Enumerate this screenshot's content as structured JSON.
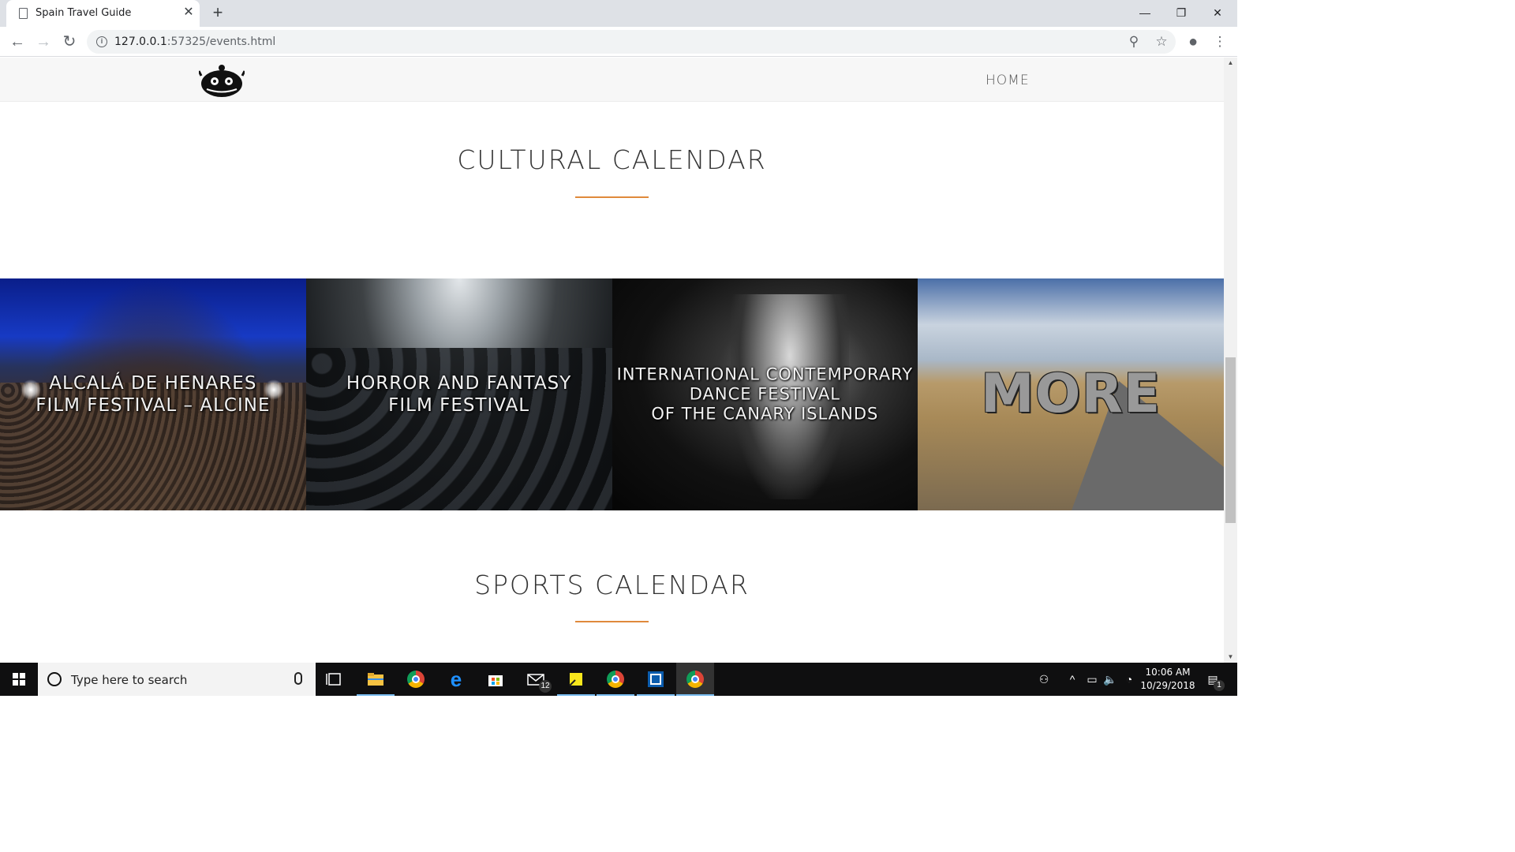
{
  "browser": {
    "tab_title": "Spain Travel Guide",
    "tab_close": "✕",
    "new_tab": "+",
    "url_host": "127.0.0.1",
    "url_rest": ":57325/events.html",
    "window_controls": {
      "minimize": "—",
      "maximize": "❐",
      "close": "✕"
    }
  },
  "site": {
    "nav": {
      "home": "HOME"
    },
    "cultural": {
      "title": "CULTURAL CALENDAR",
      "tiles": [
        {
          "label": "ALCALÁ DE HENARES\nFILM FESTIVAL – ALCINE"
        },
        {
          "label": "HORROR AND FANTASY\nFILM FESTIVAL"
        },
        {
          "label": "INTERNATIONAL CONTEMPORARY\nDANCE FESTIVAL\nOF THE CANARY ISLANDS"
        },
        {
          "label": "MORE"
        }
      ]
    },
    "sports": {
      "title": "SPORTS CALENDAR"
    },
    "accent_color": "#e08a3c"
  },
  "taskbar": {
    "search_placeholder": "Type here to search",
    "mail_badge": "12",
    "time": "10:06 AM",
    "date": "10/29/2018",
    "notification_count": "1"
  }
}
